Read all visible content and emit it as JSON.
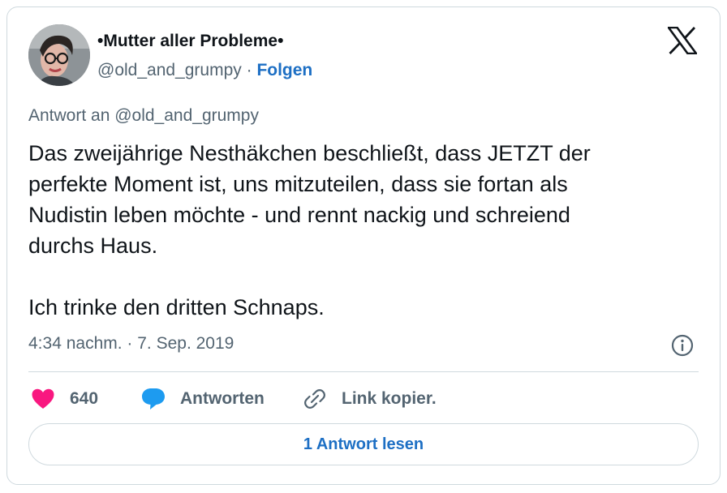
{
  "author": {
    "display_name": "•Mutter aller Probleme•",
    "handle": "@old_and_grumpy",
    "separator": " · ",
    "follow_label": "Folgen"
  },
  "brand": {
    "logo_icon": "x-logo-icon"
  },
  "tweet": {
    "reply_to": "Antwort an @old_and_grumpy",
    "text": "Das zweijährige Nesthäkchen beschließt, dass JETZT der\nperfekte Moment ist, uns mitzuteilen, dass sie fortan als\nNudistin leben möchte - und rennt nackig und schreiend\ndurchs Haus.\n\nIch trinke den dritten Schnaps.",
    "timestamp": "4:34 nachm. · 7. Sep. 2019",
    "info_icon": "info-icon"
  },
  "actions": {
    "like_count": "640",
    "like_icon": "heart-icon",
    "like_color": "#f91880",
    "reply_label": "Antworten",
    "reply_icon": "speech-bubble-icon",
    "reply_color": "#1d9bf0",
    "copy_label": "Link kopier.",
    "copy_icon": "link-icon"
  },
  "read_replies": {
    "label": "1 Antwort lesen"
  }
}
